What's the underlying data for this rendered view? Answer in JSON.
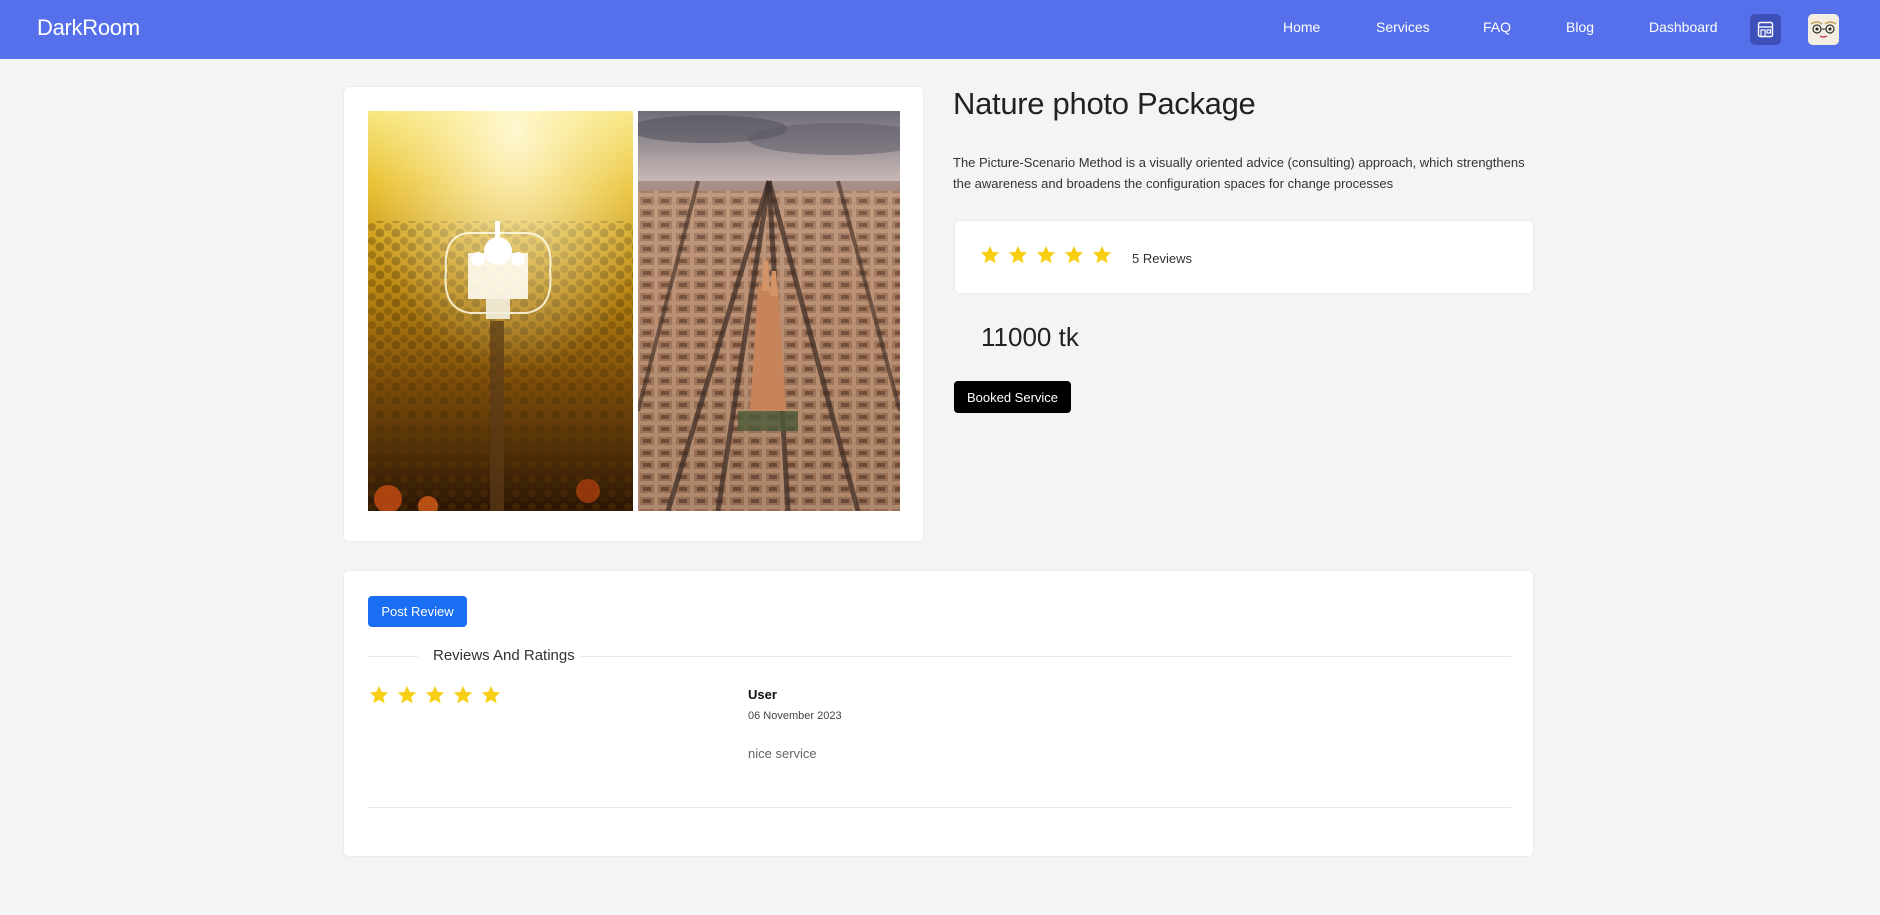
{
  "navbar": {
    "brand": "DarkRoom",
    "links": [
      "Home",
      "Services",
      "FAQ",
      "Blog",
      "Dashboard"
    ],
    "color": "#5570ea"
  },
  "product": {
    "title": "Nature photo Package",
    "description": "The Picture-Scenario Method is a visually oriented advice (consulting) approach, which strengthens the awareness and broadens the configuration spaces for change processes",
    "rating": 5,
    "rating_max": 5,
    "reviews_label": "5 Reviews",
    "price": "11000 tk",
    "book_button": "Booked Service",
    "star_color": "#f7cf16"
  },
  "reviews": {
    "post_button": "Post Review",
    "section_title": "Reviews And Ratings",
    "items": [
      {
        "user": "User",
        "date": "06 November 2023",
        "text": "nice service",
        "rating": 5
      }
    ]
  }
}
